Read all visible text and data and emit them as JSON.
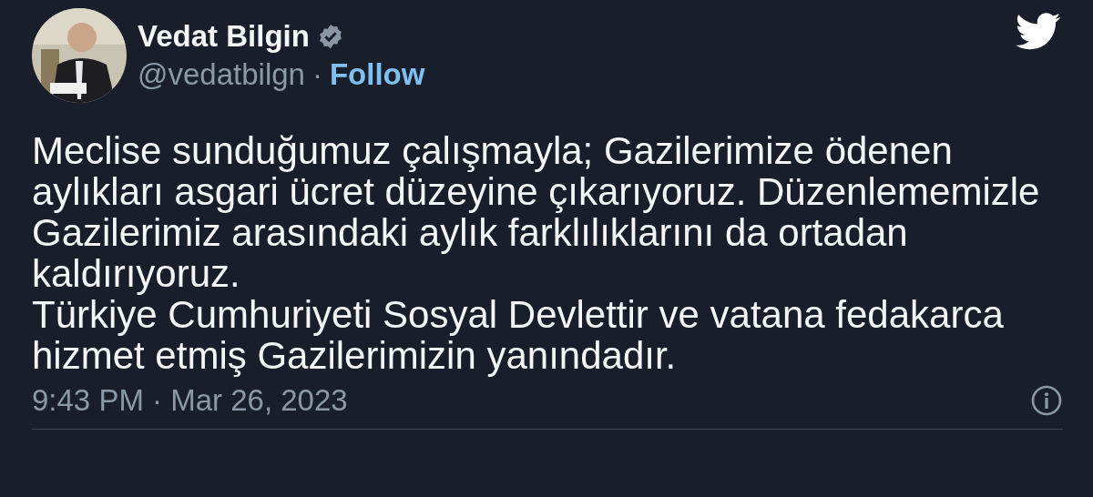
{
  "author": {
    "name": "Vedat Bilgin",
    "verified": true,
    "handle": "@vedatbilgn",
    "separator": "·",
    "follow": "Follow"
  },
  "body": [
    "Meclise sunduğumuz çalışmayla; Gazilerimize ödenen aylıkları asgari ücret düzeyine çıkarıyoruz. Düzenlememizle Gazilerimiz arasındaki aylık farklılıklarını da ortadan kaldırıyoruz.",
    "Türkiye Cumhuriyeti Sosyal Devlettir ve vatana fedakarca hizmet etmiş Gazilerimizin yanındadır."
  ],
  "timestamp": "9:43 PM · Mar 26, 2023"
}
